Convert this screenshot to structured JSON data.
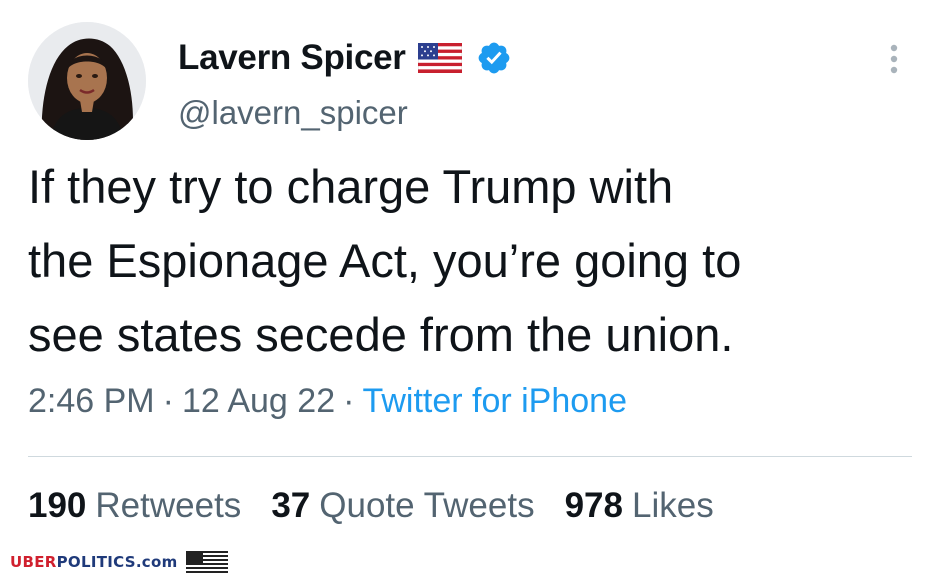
{
  "tweet": {
    "author": {
      "display_name": "Lavern Spicer",
      "handle": "@lavern_spicer",
      "flag_icon": "us-flag-icon",
      "verified_icon": "verified-badge-icon"
    },
    "text_lines": [
      "If they try to charge Trump with",
      "the Espionage Act, you’re going to",
      "see states secede from the union."
    ],
    "time": "2:46 PM",
    "date": "12 Aug 22",
    "separator": "·",
    "source": "Twitter for iPhone",
    "stats": {
      "retweets_count": "190",
      "retweets_label": "Retweets",
      "quote_tweets_count": "37",
      "quote_tweets_label": "Quote Tweets",
      "likes_count": "978",
      "likes_label": "Likes"
    }
  },
  "watermark": {
    "part1": "UBER",
    "part2": "POLITICS",
    "part3": ".com"
  },
  "colors": {
    "text_primary": "#0f1419",
    "text_secondary": "#536471",
    "link": "#1d9bf0",
    "verified": "#1d9bf0",
    "divider": "#cfd9de",
    "watermark_red": "#d0202e",
    "watermark_blue": "#1f3a7a"
  }
}
